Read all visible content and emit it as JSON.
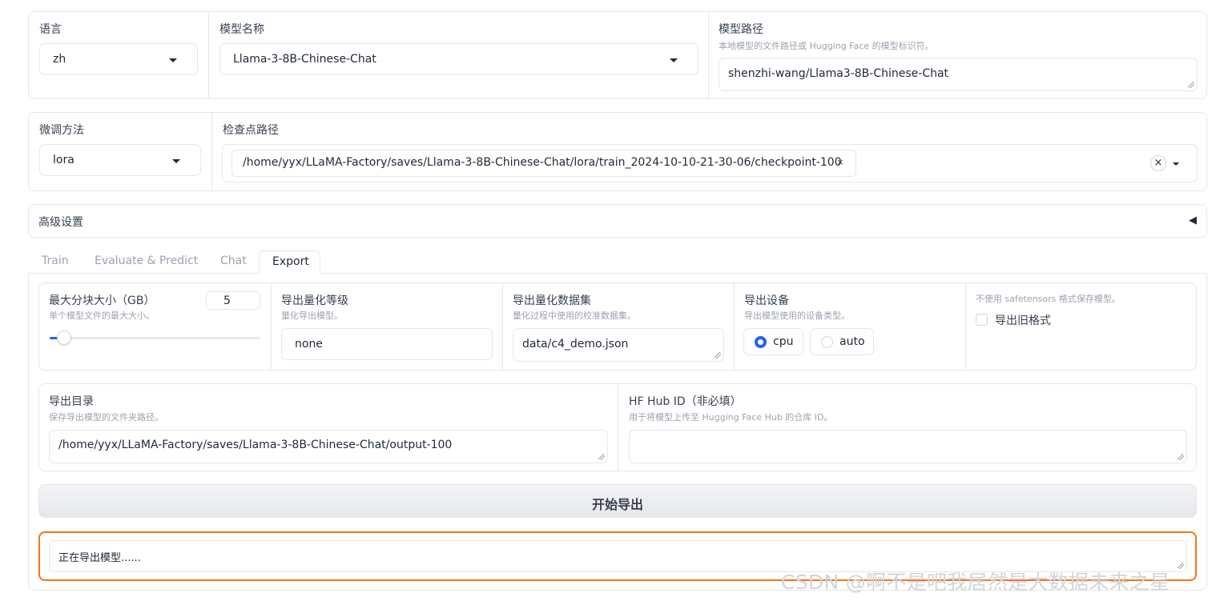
{
  "top": {
    "lang": {
      "label": "语言",
      "value": "zh"
    },
    "model_name": {
      "label": "模型名称",
      "value": "Llama-3-8B-Chinese-Chat"
    },
    "model_path": {
      "label": "模型路径",
      "info": "本地模型的文件路径或 Hugging Face 的模型标识符。",
      "value": "shenzhi-wang/Llama3-8B-Chinese-Chat"
    }
  },
  "second": {
    "finetune": {
      "label": "微调方法",
      "value": "lora"
    },
    "checkpoint": {
      "label": "检查点路径",
      "chip": "/home/yyx/LLaMA-Factory/saves/Llama-3-8B-Chinese-Chat/lora/train_2024-10-10-21-30-06/checkpoint-100",
      "chip_remove": "×",
      "clear": "×"
    }
  },
  "advanced": {
    "label": "高级设置",
    "toggle": "◀"
  },
  "tabs": [
    {
      "label": "Train"
    },
    {
      "label": "Evaluate & Predict"
    },
    {
      "label": "Chat"
    },
    {
      "label": "Export"
    }
  ],
  "active_tab": "Export",
  "export": {
    "shard": {
      "label": "最大分块大小（GB）",
      "info": "单个模型文件的最大大小。",
      "value": "5",
      "slider_fraction": 0.04
    },
    "quant_bit": {
      "label": "导出量化等级",
      "info": "量化导出模型。",
      "value": "none"
    },
    "quant_dataset": {
      "label": "导出量化数据集",
      "info": "量化过程中使用的校准数据集。",
      "value": "data/c4_demo.json"
    },
    "device": {
      "label": "导出设备",
      "info": "导出模型使用的设备类型。",
      "options": [
        "cpu",
        "auto"
      ],
      "selected": "cpu"
    },
    "legacy": {
      "info": "不使用 safetensors 格式保存模型。",
      "label": "导出旧格式",
      "checked": false
    },
    "dir": {
      "label": "导出目录",
      "info": "保存导出模型的文件夹路径。",
      "value": "/home/yyx/LLaMA-Factory/saves/Llama-3-8B-Chinese-Chat/output-100"
    },
    "hub": {
      "label": "HF Hub ID（非必填）",
      "info": "用于将模型上传至 Hugging Face Hub 的仓库 ID。",
      "value": ""
    },
    "button": "开始导出",
    "status": "正在导出模型......"
  },
  "watermark": "CSDN @啊不是吧我居然是大数据未来之星",
  "colors": {
    "accent": "#2563eb",
    "status_border": "#f97316",
    "button_bg": "#e5e7eb"
  }
}
